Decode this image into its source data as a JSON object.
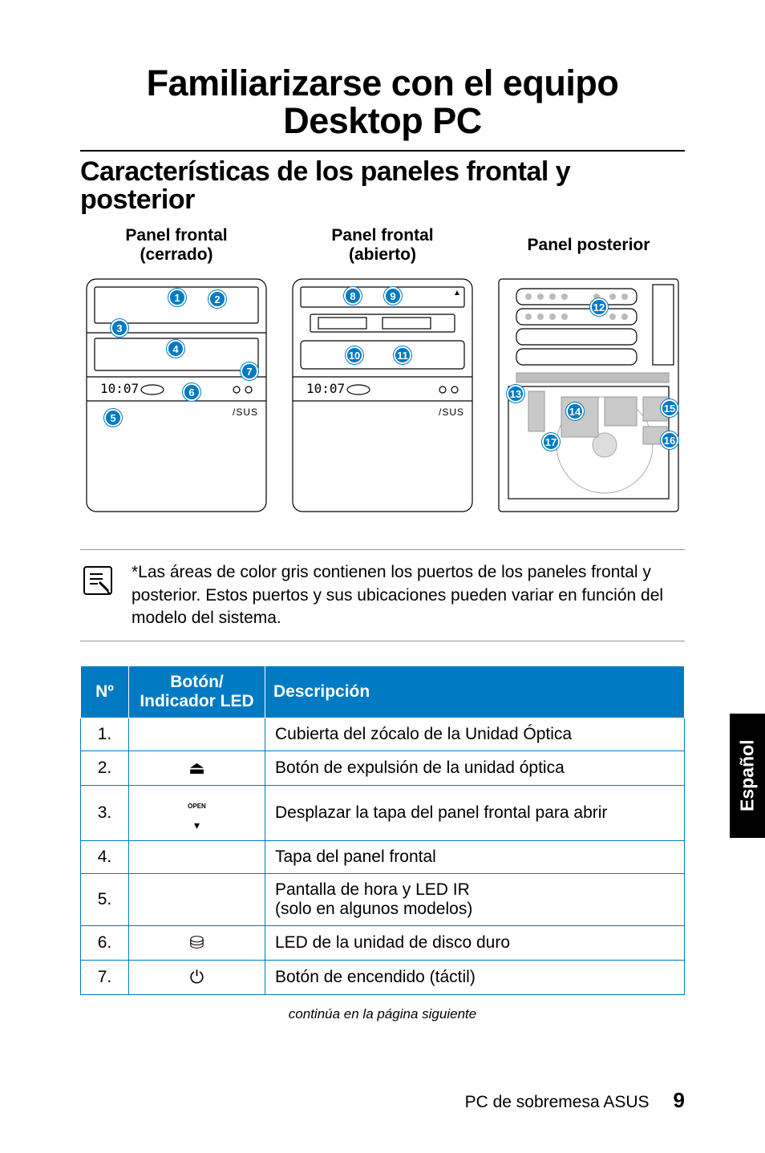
{
  "title": "Familiarizarse con el equipo Desktop PC",
  "subtitle": "Características de los paneles frontal y posterior",
  "panel_labels": {
    "front_closed_l1": "Panel frontal",
    "front_closed_l2": "(cerrado)",
    "front_open_l1": "Panel frontal",
    "front_open_l2": "(abierto)",
    "rear": "Panel posterior"
  },
  "callouts": {
    "front_closed": [
      "1",
      "2",
      "3",
      "4",
      "5",
      "6",
      "7"
    ],
    "front_open": [
      "8",
      "9",
      "10",
      "11"
    ],
    "rear": [
      "12",
      "13",
      "14",
      "15",
      "16",
      "17"
    ]
  },
  "note_text": "*Las áreas de color gris contienen los puertos de los paneles frontal y posterior. Estos puertos y sus ubicaciones pueden variar en función del modelo del sistema.",
  "table": {
    "headers": {
      "num": "Nº",
      "btn": "Botón/ Indicador LED",
      "desc": "Descripción"
    },
    "rows": [
      {
        "n": "1.",
        "icon": "",
        "desc": "Cubierta del zócalo de la Unidad Óptica"
      },
      {
        "n": "2.",
        "icon": "⏏",
        "desc": "Botón de expulsión de la unidad óptica"
      },
      {
        "n": "3.",
        "icon": "OPEN",
        "desc": "Desplazar la tapa del panel frontal para abrir"
      },
      {
        "n": "4.",
        "icon": "",
        "desc": "Tapa del panel frontal"
      },
      {
        "n": "5.",
        "icon": "",
        "desc": "Pantalla de hora y LED IR\n(solo en algunos modelos)"
      },
      {
        "n": "6.",
        "icon": "⛁",
        "desc": "LED de la unidad de disco duro"
      },
      {
        "n": "7.",
        "icon": "⏻",
        "desc": "Botón de encendido (táctil)"
      }
    ]
  },
  "continued": "continúa en la página siguiente",
  "side_tab": "Español",
  "footer_label": "PC de sobremesa ASUS",
  "page_number": "9",
  "display_time": "10:07"
}
